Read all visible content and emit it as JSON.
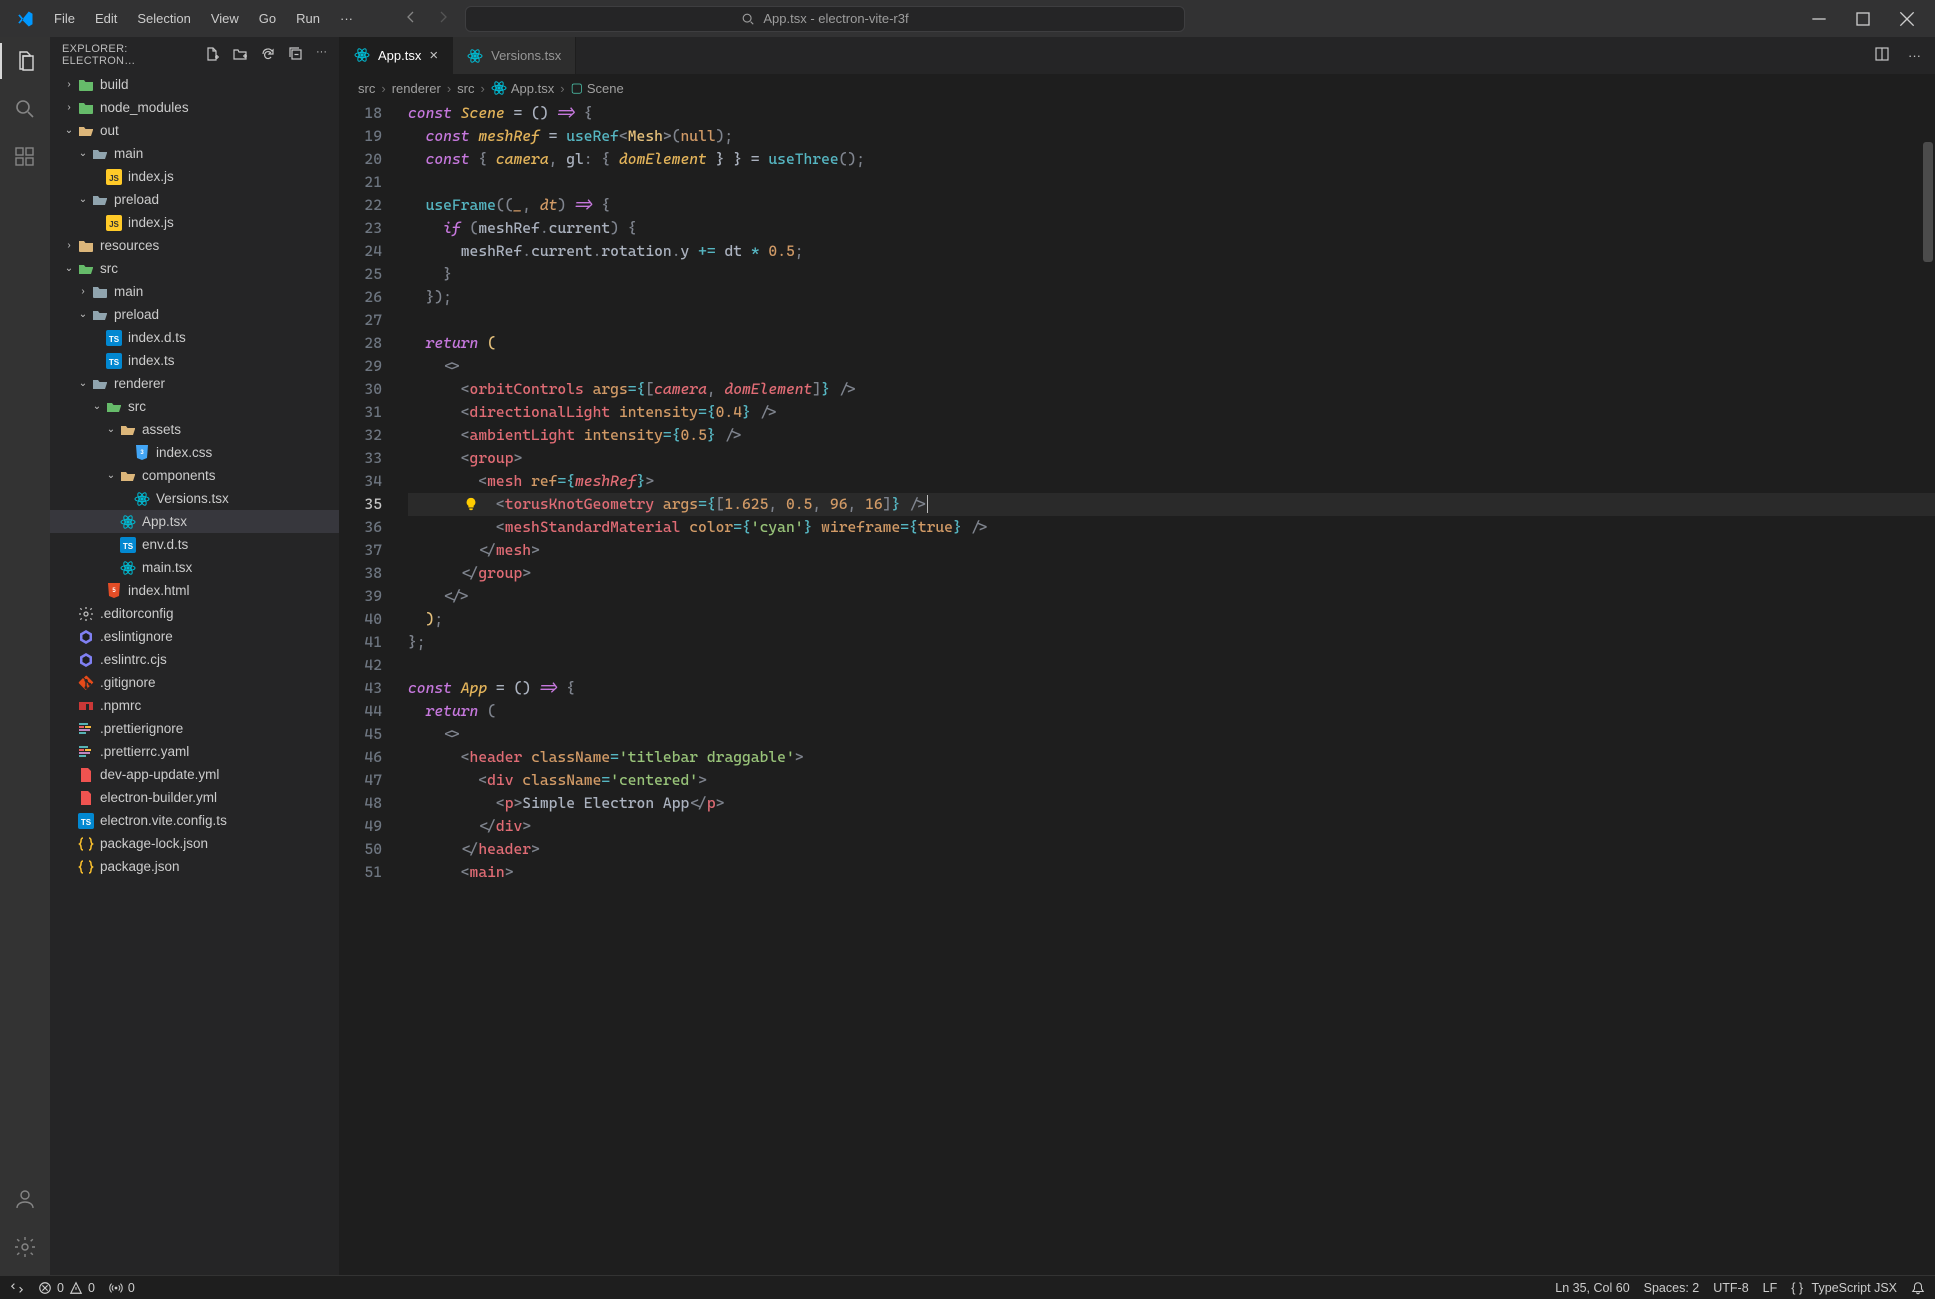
{
  "title": "App.tsx - electron-vite-r3f",
  "menus": [
    "File",
    "Edit",
    "Selection",
    "View",
    "Go",
    "Run"
  ],
  "searchPlaceholder": "App.tsx - electron-vite-r3f",
  "windowControls": {
    "minimize": "–",
    "maximize": "□",
    "close": "×"
  },
  "sidebarHeader": "EXPLORER: ELECTRON…",
  "tree": [
    {
      "depth": 0,
      "chev": "›",
      "iconCls": "folder-green",
      "icon": "folder",
      "name": "build"
    },
    {
      "depth": 0,
      "chev": "›",
      "iconCls": "folder-green",
      "icon": "folder",
      "name": "node_modules"
    },
    {
      "depth": 0,
      "chev": "⌄",
      "iconCls": "folder-yellow",
      "icon": "folder-open",
      "name": "out"
    },
    {
      "depth": 1,
      "chev": "⌄",
      "iconCls": "folder-grey",
      "icon": "folder-open",
      "name": "main"
    },
    {
      "depth": 2,
      "chev": "",
      "iconCls": "file-js",
      "icon": "js",
      "name": "index.js"
    },
    {
      "depth": 1,
      "chev": "⌄",
      "iconCls": "folder-grey",
      "icon": "folder-open",
      "name": "preload"
    },
    {
      "depth": 2,
      "chev": "",
      "iconCls": "file-js",
      "icon": "js",
      "name": "index.js"
    },
    {
      "depth": 0,
      "chev": "›",
      "iconCls": "folder-yellow",
      "icon": "folder",
      "name": "resources"
    },
    {
      "depth": 0,
      "chev": "⌄",
      "iconCls": "folder-green",
      "icon": "folder-open",
      "name": "src"
    },
    {
      "depth": 1,
      "chev": "›",
      "iconCls": "folder-grey",
      "icon": "folder",
      "name": "main"
    },
    {
      "depth": 1,
      "chev": "⌄",
      "iconCls": "folder-grey",
      "icon": "folder-open",
      "name": "preload"
    },
    {
      "depth": 2,
      "chev": "",
      "iconCls": "file-ts",
      "icon": "ts",
      "name": "index.d.ts"
    },
    {
      "depth": 2,
      "chev": "",
      "iconCls": "file-ts",
      "icon": "ts",
      "name": "index.ts"
    },
    {
      "depth": 1,
      "chev": "⌄",
      "iconCls": "folder-grey",
      "icon": "folder-open",
      "name": "renderer"
    },
    {
      "depth": 2,
      "chev": "⌄",
      "iconCls": "folder-green",
      "icon": "folder-open",
      "name": "src"
    },
    {
      "depth": 3,
      "chev": "⌄",
      "iconCls": "folder-yellow",
      "icon": "folder-open",
      "name": "assets"
    },
    {
      "depth": 4,
      "chev": "",
      "iconCls": "file-css",
      "icon": "css",
      "name": "index.css"
    },
    {
      "depth": 3,
      "chev": "⌄",
      "iconCls": "folder-yellow",
      "icon": "folder-open",
      "name": "components"
    },
    {
      "depth": 4,
      "chev": "",
      "iconCls": "file-react",
      "icon": "react",
      "name": "Versions.tsx"
    },
    {
      "depth": 3,
      "chev": "",
      "iconCls": "file-react",
      "icon": "react",
      "name": "App.tsx",
      "selected": true
    },
    {
      "depth": 3,
      "chev": "",
      "iconCls": "file-ts",
      "icon": "ts",
      "name": "env.d.ts"
    },
    {
      "depth": 3,
      "chev": "",
      "iconCls": "file-react",
      "icon": "react",
      "name": "main.tsx"
    },
    {
      "depth": 2,
      "chev": "",
      "iconCls": "file-html",
      "icon": "html",
      "name": "index.html"
    },
    {
      "depth": 0,
      "chev": "",
      "iconCls": "file-config",
      "icon": "gear",
      "name": ".editorconfig"
    },
    {
      "depth": 0,
      "chev": "",
      "iconCls": "file-eslint",
      "icon": "eslint",
      "name": ".eslintignore"
    },
    {
      "depth": 0,
      "chev": "",
      "iconCls": "file-eslint",
      "icon": "eslint",
      "name": ".eslintrc.cjs"
    },
    {
      "depth": 0,
      "chev": "",
      "iconCls": "file-git",
      "icon": "git",
      "name": ".gitignore"
    },
    {
      "depth": 0,
      "chev": "",
      "iconCls": "file-npm",
      "icon": "npm",
      "name": ".npmrc"
    },
    {
      "depth": 0,
      "chev": "",
      "iconCls": "file-prettier",
      "icon": "prettier",
      "name": ".prettierignore"
    },
    {
      "depth": 0,
      "chev": "",
      "iconCls": "file-prettier",
      "icon": "prettier",
      "name": ".prettierrc.yaml"
    },
    {
      "depth": 0,
      "chev": "",
      "iconCls": "file-yml",
      "icon": "yml",
      "name": "dev-app-update.yml"
    },
    {
      "depth": 0,
      "chev": "",
      "iconCls": "file-yml",
      "icon": "yml",
      "name": "electron-builder.yml"
    },
    {
      "depth": 0,
      "chev": "",
      "iconCls": "file-ts",
      "icon": "ts",
      "name": "electron.vite.config.ts"
    },
    {
      "depth": 0,
      "chev": "",
      "iconCls": "file-json",
      "icon": "json",
      "name": "package-lock.json"
    },
    {
      "depth": 0,
      "chev": "",
      "iconCls": "file-json",
      "icon": "json",
      "name": "package.json"
    }
  ],
  "tabs": [
    {
      "label": "App.tsx",
      "icon": "react",
      "active": true
    },
    {
      "label": "Versions.tsx",
      "icon": "react",
      "active": false
    }
  ],
  "breadcrumbs": [
    "src",
    "renderer",
    "src",
    "App.tsx",
    "Scene"
  ],
  "lineStart": 18,
  "currentLine": 35,
  "code": [
    [
      {
        "t": "const ",
        "c": "tk-kw"
      },
      {
        "t": "Scene",
        "c": "tk-var2"
      },
      {
        "t": " = () ",
        "c": "tk-prop"
      },
      {
        "t": "=>",
        "c": "tk-kw"
      },
      {
        "t": " {",
        "c": "tk-punc"
      }
    ],
    [
      {
        "t": "  ",
        "c": ""
      },
      {
        "t": "const ",
        "c": "tk-kw"
      },
      {
        "t": "meshRef",
        "c": "tk-var2"
      },
      {
        "t": " = ",
        "c": "tk-prop"
      },
      {
        "t": "useRef",
        "c": "tk-fn"
      },
      {
        "t": "<",
        "c": "tk-punc"
      },
      {
        "t": "Mesh",
        "c": "tk-cls"
      },
      {
        "t": ">(",
        "c": "tk-punc"
      },
      {
        "t": "null",
        "c": "tk-const"
      },
      {
        "t": ");",
        "c": "tk-punc"
      }
    ],
    [
      {
        "t": "  ",
        "c": ""
      },
      {
        "t": "const ",
        "c": "tk-kw"
      },
      {
        "t": "{ ",
        "c": "tk-punc"
      },
      {
        "t": "camera",
        "c": "tk-var2"
      },
      {
        "t": ", ",
        "c": "tk-punc"
      },
      {
        "t": "gl",
        "c": "tk-prop"
      },
      {
        "t": ": { ",
        "c": "tk-punc"
      },
      {
        "t": "domElement",
        "c": "tk-var2"
      },
      {
        "t": " } } = ",
        "c": "tk-prop"
      },
      {
        "t": "useThree",
        "c": "tk-fn"
      },
      {
        "t": "();",
        "c": "tk-punc"
      }
    ],
    [
      {
        "t": "",
        "c": ""
      }
    ],
    [
      {
        "t": "  ",
        "c": ""
      },
      {
        "t": "useFrame",
        "c": "tk-fn"
      },
      {
        "t": "((",
        "c": "tk-punc"
      },
      {
        "t": "_",
        "c": "tk-param"
      },
      {
        "t": ", ",
        "c": "tk-punc"
      },
      {
        "t": "dt",
        "c": "tk-param"
      },
      {
        "t": ") ",
        "c": "tk-punc"
      },
      {
        "t": "=>",
        "c": "tk-kw"
      },
      {
        "t": " {",
        "c": "tk-punc"
      }
    ],
    [
      {
        "t": "    ",
        "c": ""
      },
      {
        "t": "if ",
        "c": "tk-kw"
      },
      {
        "t": "(",
        "c": "tk-punc"
      },
      {
        "t": "meshRef",
        "c": "tk-prop"
      },
      {
        "t": ".",
        "c": "tk-punc"
      },
      {
        "t": "current",
        "c": "tk-prop"
      },
      {
        "t": ") {",
        "c": "tk-punc"
      }
    ],
    [
      {
        "t": "      ",
        "c": ""
      },
      {
        "t": "meshRef",
        "c": "tk-prop"
      },
      {
        "t": ".",
        "c": "tk-punc"
      },
      {
        "t": "current",
        "c": "tk-prop"
      },
      {
        "t": ".",
        "c": "tk-punc"
      },
      {
        "t": "rotation",
        "c": "tk-prop"
      },
      {
        "t": ".",
        "c": "tk-punc"
      },
      {
        "t": "y",
        "c": "tk-prop"
      },
      {
        "t": " += ",
        "c": "tk-op"
      },
      {
        "t": "dt",
        "c": "tk-prop"
      },
      {
        "t": " * ",
        "c": "tk-op"
      },
      {
        "t": "0.5",
        "c": "tk-num"
      },
      {
        "t": ";",
        "c": "tk-punc"
      }
    ],
    [
      {
        "t": "    }",
        "c": "tk-punc"
      }
    ],
    [
      {
        "t": "  });",
        "c": "tk-punc"
      }
    ],
    [
      {
        "t": "",
        "c": ""
      }
    ],
    [
      {
        "t": "  ",
        "c": ""
      },
      {
        "t": "return ",
        "c": "tk-kw"
      },
      {
        "t": "(",
        "c": "tk-var"
      }
    ],
    [
      {
        "t": "    ",
        "c": ""
      },
      {
        "t": "<>",
        "c": "tk-punc"
      }
    ],
    [
      {
        "t": "      ",
        "c": ""
      },
      {
        "t": "<",
        "c": "tk-punc"
      },
      {
        "t": "orbitControls",
        "c": "tk-tag"
      },
      {
        "t": " ",
        "c": ""
      },
      {
        "t": "args",
        "c": "tk-attr"
      },
      {
        "t": "={",
        "c": "tk-op"
      },
      {
        "t": "[",
        "c": "tk-punc"
      },
      {
        "t": "camera",
        "c": "tk-jsxRef"
      },
      {
        "t": ", ",
        "c": "tk-punc"
      },
      {
        "t": "domElement",
        "c": "tk-jsxRef"
      },
      {
        "t": "]",
        "c": "tk-punc"
      },
      {
        "t": "}",
        "c": "tk-op"
      },
      {
        "t": " />",
        "c": "tk-punc"
      }
    ],
    [
      {
        "t": "      ",
        "c": ""
      },
      {
        "t": "<",
        "c": "tk-punc"
      },
      {
        "t": "directionalLight",
        "c": "tk-tag"
      },
      {
        "t": " ",
        "c": ""
      },
      {
        "t": "intensity",
        "c": "tk-attr"
      },
      {
        "t": "={",
        "c": "tk-op"
      },
      {
        "t": "0.4",
        "c": "tk-num"
      },
      {
        "t": "}",
        "c": "tk-op"
      },
      {
        "t": " />",
        "c": "tk-punc"
      }
    ],
    [
      {
        "t": "      ",
        "c": ""
      },
      {
        "t": "<",
        "c": "tk-punc"
      },
      {
        "t": "ambientLight",
        "c": "tk-tag"
      },
      {
        "t": " ",
        "c": ""
      },
      {
        "t": "intensity",
        "c": "tk-attr"
      },
      {
        "t": "={",
        "c": "tk-op"
      },
      {
        "t": "0.5",
        "c": "tk-num"
      },
      {
        "t": "}",
        "c": "tk-op"
      },
      {
        "t": " />",
        "c": "tk-punc"
      }
    ],
    [
      {
        "t": "      ",
        "c": ""
      },
      {
        "t": "<",
        "c": "tk-punc"
      },
      {
        "t": "group",
        "c": "tk-tag"
      },
      {
        "t": ">",
        "c": "tk-punc"
      }
    ],
    [
      {
        "t": "        ",
        "c": ""
      },
      {
        "t": "<",
        "c": "tk-punc"
      },
      {
        "t": "mesh",
        "c": "tk-tag"
      },
      {
        "t": " ",
        "c": ""
      },
      {
        "t": "ref",
        "c": "tk-attr"
      },
      {
        "t": "={",
        "c": "tk-op"
      },
      {
        "t": "meshRef",
        "c": "tk-jsxRef"
      },
      {
        "t": "}",
        "c": "tk-op"
      },
      {
        "t": ">",
        "c": "tk-punc"
      }
    ],
    [
      {
        "t": "          ",
        "c": ""
      },
      {
        "t": "<",
        "c": "tk-punc"
      },
      {
        "t": "torusKnotGeometry",
        "c": "tk-tag"
      },
      {
        "t": " ",
        "c": ""
      },
      {
        "t": "args",
        "c": "tk-attr"
      },
      {
        "t": "={",
        "c": "tk-op"
      },
      {
        "t": "[",
        "c": "tk-punc"
      },
      {
        "t": "1.625",
        "c": "tk-num"
      },
      {
        "t": ", ",
        "c": "tk-punc"
      },
      {
        "t": "0.5",
        "c": "tk-num"
      },
      {
        "t": ", ",
        "c": "tk-punc"
      },
      {
        "t": "96",
        "c": "tk-num"
      },
      {
        "t": ", ",
        "c": "tk-punc"
      },
      {
        "t": "16",
        "c": "tk-num"
      },
      {
        "t": "]",
        "c": "tk-punc"
      },
      {
        "t": "}",
        "c": "tk-op"
      },
      {
        "t": " />",
        "c": "tk-punc"
      },
      {
        "t": "",
        "c": "cursor"
      }
    ],
    [
      {
        "t": "          ",
        "c": ""
      },
      {
        "t": "<",
        "c": "tk-punc"
      },
      {
        "t": "meshStandardMaterial",
        "c": "tk-tag"
      },
      {
        "t": " ",
        "c": ""
      },
      {
        "t": "color",
        "c": "tk-attr"
      },
      {
        "t": "={",
        "c": "tk-op"
      },
      {
        "t": "'cyan'",
        "c": "tk-str"
      },
      {
        "t": "}",
        "c": "tk-op"
      },
      {
        "t": " ",
        "c": ""
      },
      {
        "t": "wireframe",
        "c": "tk-attr"
      },
      {
        "t": "={",
        "c": "tk-op"
      },
      {
        "t": "true",
        "c": "tk-const"
      },
      {
        "t": "}",
        "c": "tk-op"
      },
      {
        "t": " />",
        "c": "tk-punc"
      }
    ],
    [
      {
        "t": "        ",
        "c": ""
      },
      {
        "t": "</",
        "c": "tk-punc"
      },
      {
        "t": "mesh",
        "c": "tk-tag"
      },
      {
        "t": ">",
        "c": "tk-punc"
      }
    ],
    [
      {
        "t": "      ",
        "c": ""
      },
      {
        "t": "</",
        "c": "tk-punc"
      },
      {
        "t": "group",
        "c": "tk-tag"
      },
      {
        "t": ">",
        "c": "tk-punc"
      }
    ],
    [
      {
        "t": "    ",
        "c": ""
      },
      {
        "t": "</>",
        "c": "tk-punc"
      }
    ],
    [
      {
        "t": "  ",
        "c": ""
      },
      {
        "t": ")",
        "c": "tk-var"
      },
      {
        "t": ";",
        "c": "tk-punc"
      }
    ],
    [
      {
        "t": "};",
        "c": "tk-punc"
      }
    ],
    [
      {
        "t": "",
        "c": ""
      }
    ],
    [
      {
        "t": "const ",
        "c": "tk-kw"
      },
      {
        "t": "App",
        "c": "tk-var2"
      },
      {
        "t": " = () ",
        "c": "tk-prop"
      },
      {
        "t": "=>",
        "c": "tk-kw"
      },
      {
        "t": " {",
        "c": "tk-punc"
      }
    ],
    [
      {
        "t": "  ",
        "c": ""
      },
      {
        "t": "return ",
        "c": "tk-kw"
      },
      {
        "t": "(",
        "c": "tk-punc"
      }
    ],
    [
      {
        "t": "    ",
        "c": ""
      },
      {
        "t": "<>",
        "c": "tk-punc"
      }
    ],
    [
      {
        "t": "      ",
        "c": ""
      },
      {
        "t": "<",
        "c": "tk-punc"
      },
      {
        "t": "header",
        "c": "tk-tag"
      },
      {
        "t": " ",
        "c": ""
      },
      {
        "t": "className",
        "c": "tk-attr"
      },
      {
        "t": "=",
        "c": "tk-op"
      },
      {
        "t": "'titlebar draggable'",
        "c": "tk-str"
      },
      {
        "t": ">",
        "c": "tk-punc"
      }
    ],
    [
      {
        "t": "        ",
        "c": ""
      },
      {
        "t": "<",
        "c": "tk-punc"
      },
      {
        "t": "div",
        "c": "tk-tag"
      },
      {
        "t": " ",
        "c": ""
      },
      {
        "t": "className",
        "c": "tk-attr"
      },
      {
        "t": "=",
        "c": "tk-op"
      },
      {
        "t": "'centered'",
        "c": "tk-str"
      },
      {
        "t": ">",
        "c": "tk-punc"
      }
    ],
    [
      {
        "t": "          ",
        "c": ""
      },
      {
        "t": "<",
        "c": "tk-punc"
      },
      {
        "t": "p",
        "c": "tk-tag"
      },
      {
        "t": ">",
        "c": "tk-punc"
      },
      {
        "t": "Simple Electron App",
        "c": "tk-prop"
      },
      {
        "t": "</",
        "c": "tk-punc"
      },
      {
        "t": "p",
        "c": "tk-tag"
      },
      {
        "t": ">",
        "c": "tk-punc"
      }
    ],
    [
      {
        "t": "        ",
        "c": ""
      },
      {
        "t": "</",
        "c": "tk-punc"
      },
      {
        "t": "div",
        "c": "tk-tag"
      },
      {
        "t": ">",
        "c": "tk-punc"
      }
    ],
    [
      {
        "t": "      ",
        "c": ""
      },
      {
        "t": "</",
        "c": "tk-punc"
      },
      {
        "t": "header",
        "c": "tk-tag"
      },
      {
        "t": ">",
        "c": "tk-punc"
      }
    ],
    [
      {
        "t": "      ",
        "c": ""
      },
      {
        "t": "<",
        "c": "tk-punc"
      },
      {
        "t": "main",
        "c": "tk-tag"
      },
      {
        "t": ">",
        "c": "tk-punc"
      }
    ]
  ],
  "status": {
    "remote": "⤫",
    "errors": "0",
    "warnings": "0",
    "radio": "0",
    "lncol": "Ln 35, Col 60",
    "spaces": "Spaces: 2",
    "encoding": "UTF-8",
    "eol": "LF",
    "lang": "TypeScript JSX"
  }
}
